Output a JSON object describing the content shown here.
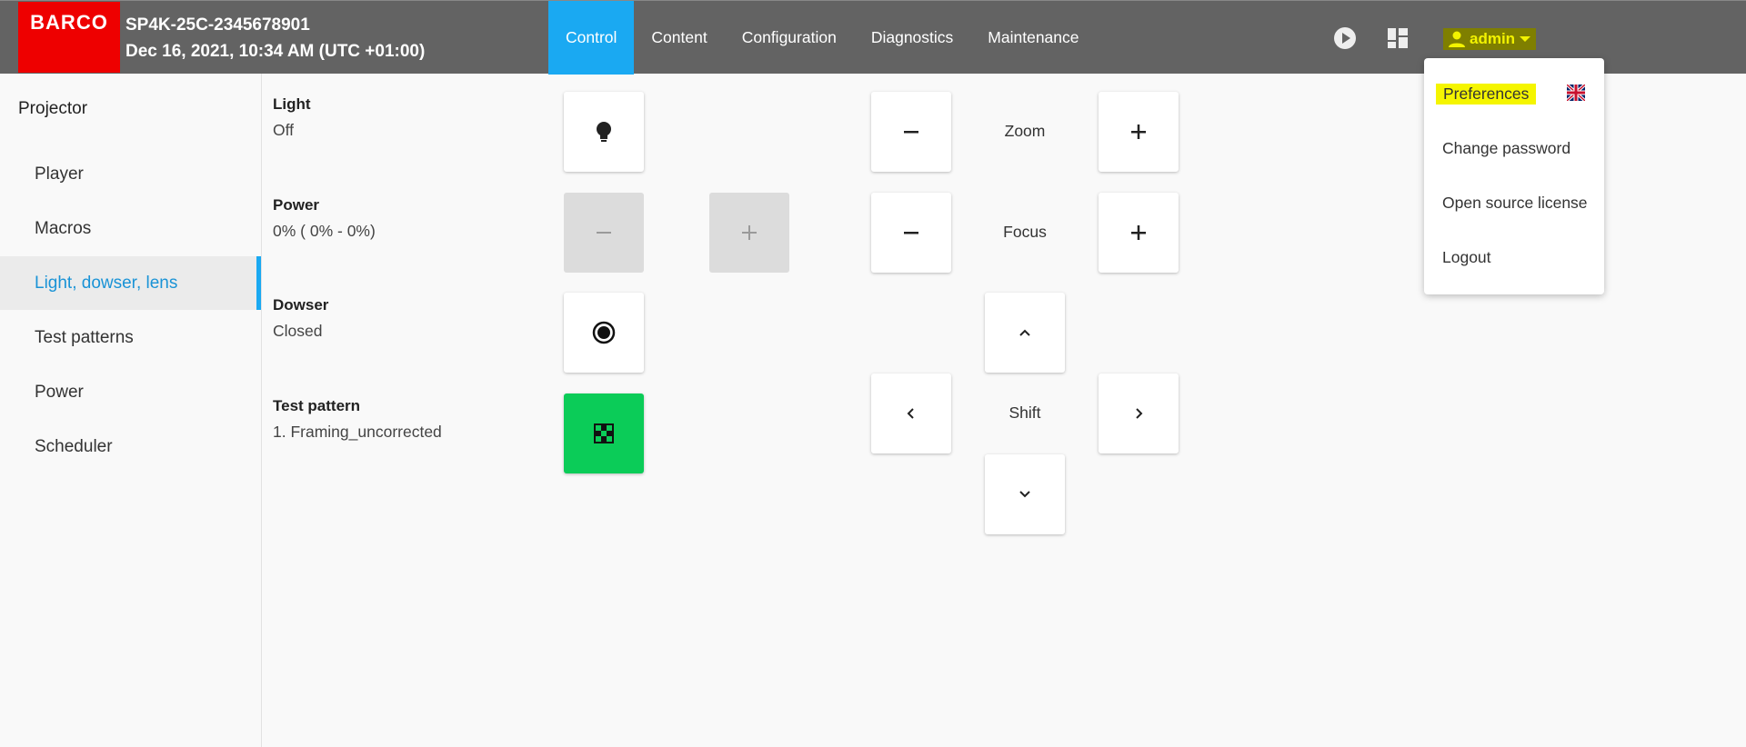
{
  "header": {
    "logo_text": "BARCO",
    "device_name": "SP4K-25C-2345678901",
    "datetime": "Dec 16, 2021, 10:34 AM (UTC +01:00)",
    "tabs": [
      {
        "label": "Control",
        "active": true
      },
      {
        "label": "Content",
        "active": false
      },
      {
        "label": "Configuration",
        "active": false
      },
      {
        "label": "Diagnostics",
        "active": false
      },
      {
        "label": "Maintenance",
        "active": false
      }
    ],
    "icons": [
      "play-icon",
      "dashboard-icon"
    ],
    "user": "admin"
  },
  "sidebar": {
    "title": "Projector",
    "items": [
      {
        "label": "Player",
        "active": false
      },
      {
        "label": "Macros",
        "active": false
      },
      {
        "label": "Light, dowser, lens",
        "active": true
      },
      {
        "label": "Test patterns",
        "active": false
      },
      {
        "label": "Power",
        "active": false
      },
      {
        "label": "Scheduler",
        "active": false
      }
    ]
  },
  "main": {
    "light": {
      "label": "Light",
      "value": "Off"
    },
    "power": {
      "label": "Power",
      "value": "0% ( 0% - 0%)"
    },
    "dowser": {
      "label": "Dowser",
      "value": "Closed"
    },
    "test_pattern": {
      "label": "Test pattern",
      "value": "1. Framing_uncorrected"
    },
    "zoom_label": "Zoom",
    "focus_label": "Focus",
    "shift_label": "Shift"
  },
  "user_dropdown": {
    "items": [
      "Preferences",
      "Change password",
      "Open source license",
      "Logout"
    ],
    "language_icon": "uk-flag-icon"
  },
  "colors": {
    "header_bg": "#636363",
    "accent": "#1aa9f2",
    "logo_red": "#ee0000",
    "green": "#0bcc58",
    "highlight": "#f5f500"
  }
}
